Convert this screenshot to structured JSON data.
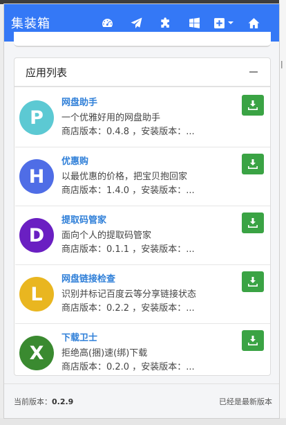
{
  "navbar": {
    "brand": "集装箱",
    "icons": [
      "dashboard-icon",
      "paper-plane-icon",
      "puzzle-icon",
      "windows-icon",
      "plus-square-icon",
      "home-icon"
    ]
  },
  "panel": {
    "title": "应用列表",
    "collapse_symbol": "minus"
  },
  "apps": [
    {
      "initial": "P",
      "color": "#5cc9d3",
      "name": "网盘助手",
      "desc": "一个优雅好用的网盘助手",
      "version_line": "商店版本：0.4.8 ，安装版本：..."
    },
    {
      "initial": "H",
      "color": "#4f6de6",
      "name": "优惠购",
      "desc": "以最优惠的价格，把宝贝抱回家",
      "version_line": "商店版本：1.4.0 ，安装版本：..."
    },
    {
      "initial": "D",
      "color": "#6a1fc2",
      "name": "提取码管家",
      "desc": "面向个人的提取码管家",
      "version_line": "商店版本：0.1.1 ，安装版本：..."
    },
    {
      "initial": "L",
      "color": "#e9b620",
      "name": "网盘链接检查",
      "desc": "识别并标记百度云等分享链接状态",
      "version_line": "商店版本：0.2.2 ，安装版本：..."
    },
    {
      "initial": "X",
      "color": "#3a8a30",
      "name": "下载卫士",
      "desc": "拒绝高(捆)速(绑)下载",
      "version_line": "商店版本：0.2.0 ，安装版本：..."
    }
  ],
  "footer": {
    "current_label": "当前版本：",
    "current_version": "0.2.9",
    "status": "已经是最新版本"
  },
  "colors": {
    "navbar": "#3478f6",
    "download_button": "#3aa344",
    "link": "#2f7fd8"
  }
}
